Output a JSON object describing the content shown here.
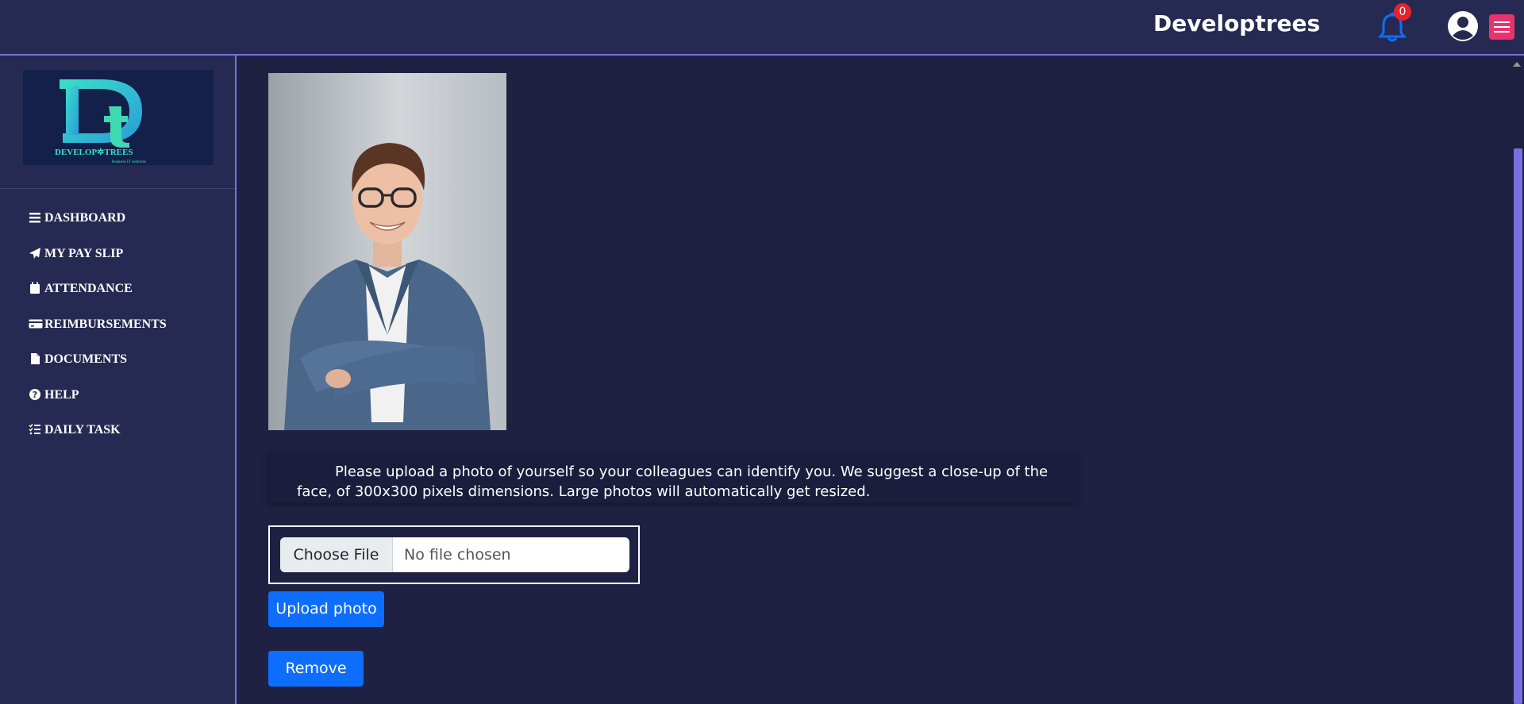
{
  "header": {
    "brand": "Developtrees",
    "notification_count": "0"
  },
  "logo": {
    "wordmark": "DEVELOP TREES",
    "tagline": "Business IT solutions"
  },
  "sidebar": {
    "items": [
      {
        "label": "DASHBOARD",
        "icon": "bars-icon"
      },
      {
        "label": "MY PAY SLIP",
        "icon": "paper-plane-icon"
      },
      {
        "label": "ATTENDANCE",
        "icon": "calendar-icon"
      },
      {
        "label": "REIMBURSEMENTS",
        "icon": "credit-card-icon"
      },
      {
        "label": "DOCUMENTS",
        "icon": "file-icon"
      },
      {
        "label": "HELP",
        "icon": "question-circle-icon"
      },
      {
        "label": "DAILY TASK",
        "icon": "list-check-icon"
      }
    ]
  },
  "main": {
    "info_text": "Please upload a photo of yourself so your colleagues can identify you. We suggest a close-up of the face, of 300x300 pixels dimensions. Large photos will automatically get resized.",
    "file_input": {
      "button_label": "Choose File",
      "status": "No file chosen"
    },
    "upload_label": "Upload photo",
    "remove_label": "Remove"
  },
  "colors": {
    "background": "#1f2142",
    "panel": "#262a52",
    "accent": "#7a6fe0",
    "primary_button": "#0d6efd",
    "menu_button": "#e8336f",
    "badge": "#e8222a",
    "bell": "#0d6efd"
  }
}
